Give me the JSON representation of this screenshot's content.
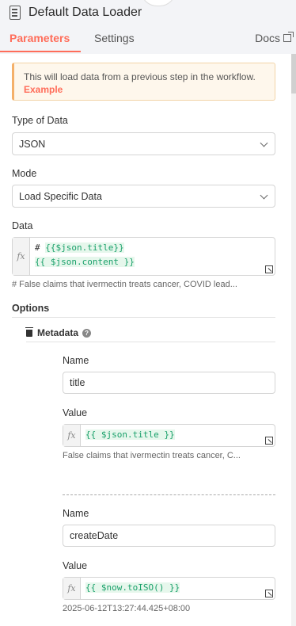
{
  "header": {
    "title": "Default Data Loader",
    "icon": "document-icon",
    "tabs": [
      {
        "label": "Parameters",
        "active": true
      },
      {
        "label": "Settings",
        "active": false
      }
    ],
    "docs_label": "Docs"
  },
  "notice": {
    "text": "This will load data from a previous step in the workflow.",
    "link": "Example"
  },
  "type_of_data": {
    "label": "Type of Data",
    "value": "JSON"
  },
  "mode": {
    "label": "Mode",
    "value": "Load Specific Data"
  },
  "data_field": {
    "label": "Data",
    "fx": "fx",
    "line1_prefix": "# ",
    "line1_token": "{{$json.title}}",
    "line2_token": "{{ $json.content }}",
    "preview": "# False claims that ivermectin treats cancer, COVID lead..."
  },
  "options": {
    "label": "Options",
    "metadata_label": "Metadata",
    "entries": [
      {
        "name_label": "Name",
        "name_value": "title",
        "value_label": "Value",
        "value_token": "{{ $json.title }}",
        "value_preview": "False claims that ivermectin treats cancer, C..."
      },
      {
        "name_label": "Name",
        "name_value": "createDate",
        "value_label": "Value",
        "value_token": "{{ $now.toISO() }}",
        "value_preview": "2025-06-12T13:27:44.425+08:00"
      }
    ]
  },
  "colors": {
    "accent": "#ff6d5a",
    "notice_bg": "#fef7ec",
    "token": "#19a06a"
  }
}
